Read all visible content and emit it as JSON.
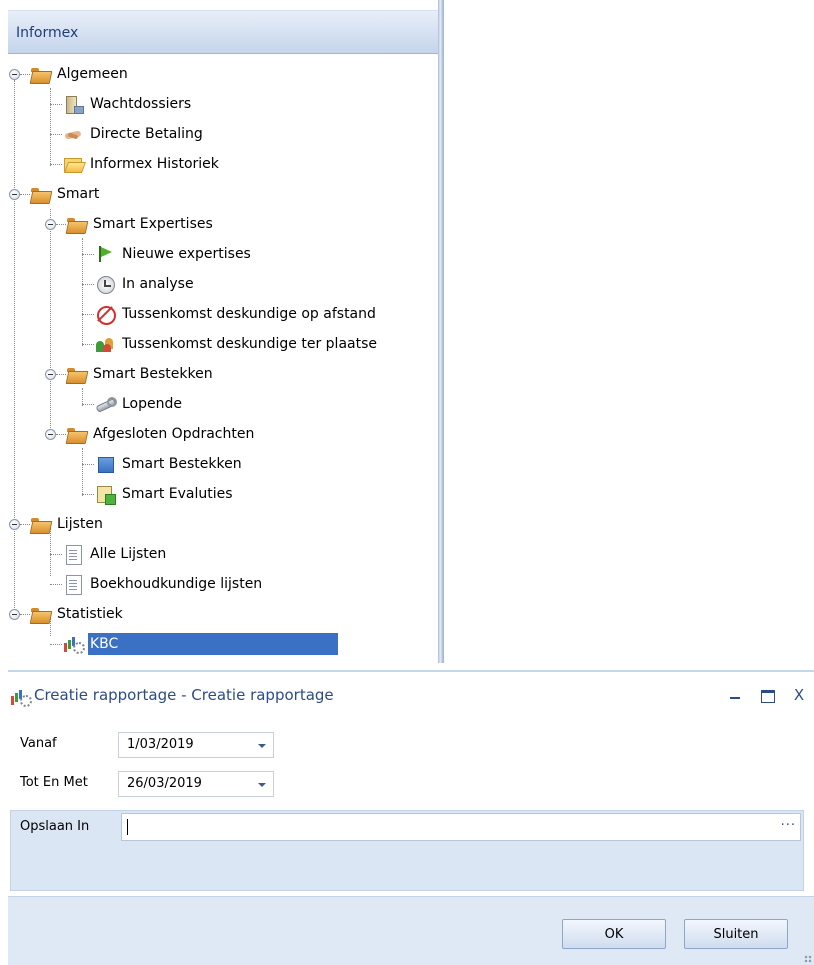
{
  "tree": {
    "header_title": "Informex",
    "nodes": [
      {
        "label": "Algemeen"
      },
      {
        "label": "Wachtdossiers"
      },
      {
        "label": "Directe Betaling"
      },
      {
        "label": "Informex Historiek"
      },
      {
        "label": "Smart"
      },
      {
        "label": "Smart Expertises"
      },
      {
        "label": "Nieuwe expertises"
      },
      {
        "label": "In analyse"
      },
      {
        "label": "Tussenkomst deskundige op afstand"
      },
      {
        "label": "Tussenkomst deskundige ter plaatse"
      },
      {
        "label": "Smart Bestekken"
      },
      {
        "label": "Lopende"
      },
      {
        "label": "Afgesloten Opdrachten"
      },
      {
        "label": "Smart Bestekken"
      },
      {
        "label": "Smart Evaluties"
      },
      {
        "label": "Lijsten"
      },
      {
        "label": "Alle Lijsten"
      },
      {
        "label": "Boekhoudkundige lijsten"
      },
      {
        "label": "Statistiek"
      },
      {
        "label": "KBC",
        "selected": true
      }
    ]
  },
  "dialog": {
    "title": "Creatie rapportage - Creatie rapportage",
    "window_buttons": {
      "close": "X"
    },
    "fields": {
      "from_label": "Vanaf",
      "from_value": "1/03/2019",
      "to_label": "Tot En Met",
      "to_value": "26/03/2019",
      "save_label": "Opslaan In",
      "save_value": "",
      "browse": "···"
    },
    "buttons": {
      "ok": "OK",
      "close": "Sluiten"
    }
  },
  "colors": {
    "selection": "#3a71c5",
    "title_text": "#2d4c86",
    "panel_bg": "#dbe6f4"
  }
}
